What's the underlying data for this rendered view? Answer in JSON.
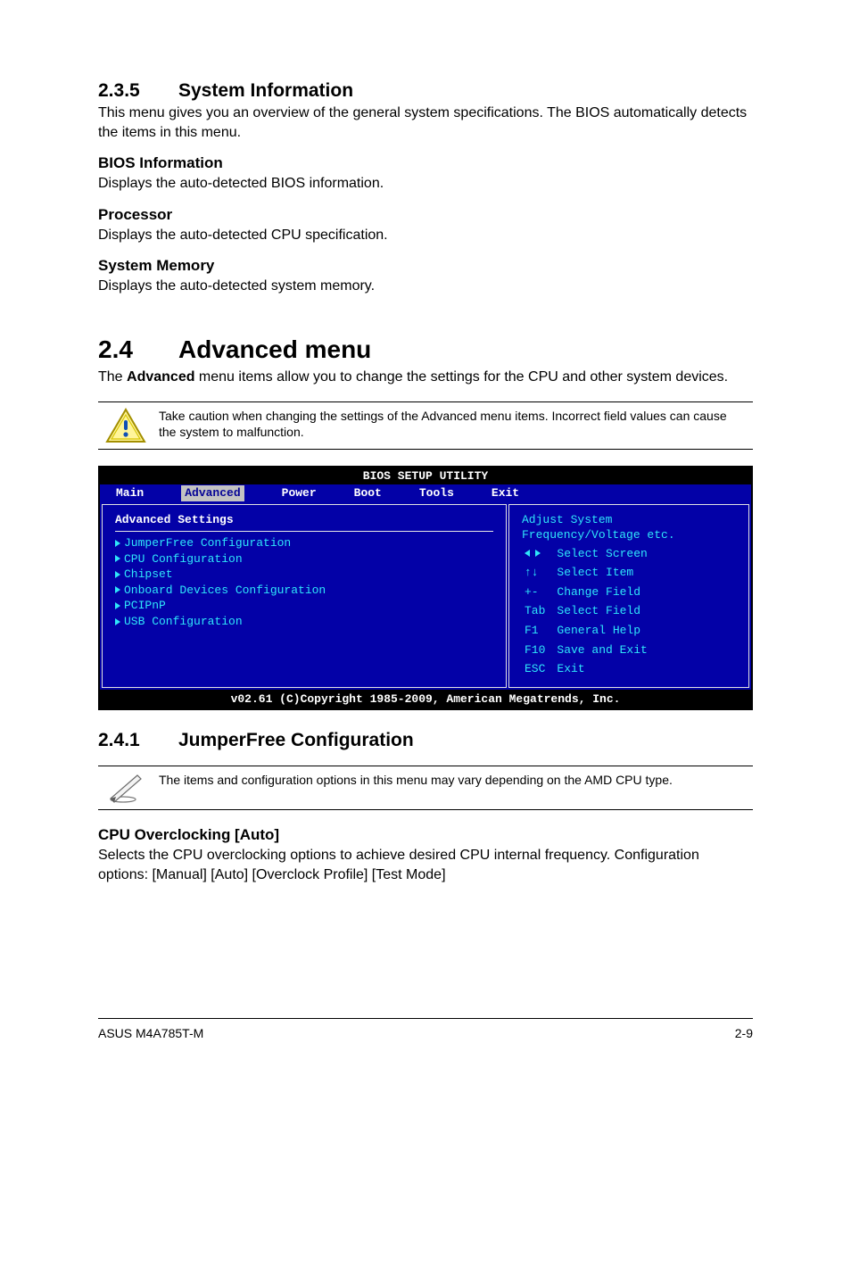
{
  "sec235": {
    "num": "2.3.5",
    "title": "System Information",
    "intro": "This menu gives you an overview of the general system specifications. The BIOS automatically detects the items in this menu.",
    "bios_info_h": "BIOS Information",
    "bios_info_t": "Displays the auto-detected BIOS information.",
    "proc_h": "Processor",
    "proc_t": "Displays the auto-detected CPU specification.",
    "mem_h": "System Memory",
    "mem_t": "Displays the auto-detected system memory."
  },
  "sec24": {
    "num": "2.4",
    "title": "Advanced menu",
    "intro_pre": "The ",
    "intro_bold": "Advanced",
    "intro_post": " menu items allow you to change the settings for the CPU and other system devices.",
    "caution": "Take caution when changing the settings of the Advanced menu items. Incorrect field values can cause the system to malfunction."
  },
  "bios": {
    "title": "BIOS SETUP UTILITY",
    "tabs": [
      "Main",
      "Advanced",
      "Power",
      "Boot",
      "Tools",
      "Exit"
    ],
    "heading": "Advanced Settings",
    "items": [
      "JumperFree Configuration",
      "CPU Configuration",
      "Chipset",
      "Onboard Devices Configuration",
      "PCIPnP",
      "USB Configuration"
    ],
    "right_top": "Adjust System Frequency/Voltage etc.",
    "help": [
      {
        "k": "__arrows_lr__",
        "v": "Select Screen"
      },
      {
        "k": "__arrows_ud__",
        "v": "Select Item"
      },
      {
        "k": "+-",
        "v": "Change Field"
      },
      {
        "k": "Tab",
        "v": "Select Field"
      },
      {
        "k": "F1",
        "v": "General Help"
      },
      {
        "k": "F10",
        "v": "Save and Exit"
      },
      {
        "k": "ESC",
        "v": "Exit"
      }
    ],
    "footer": "v02.61 (C)Copyright 1985-2009, American Megatrends, Inc."
  },
  "sec241": {
    "num": "2.4.1",
    "title": "JumperFree Configuration",
    "note": "The items and configuration options in this menu may vary depending on the AMD CPU type.",
    "oc_h": "CPU Overclocking [Auto]",
    "oc_t": "Selects the CPU overclocking options to achieve desired CPU internal frequency. Configuration options: [Manual] [Auto] [Overclock Profile] [Test Mode]"
  },
  "footer": {
    "left": "ASUS M4A785T-M",
    "right": "2-9"
  }
}
